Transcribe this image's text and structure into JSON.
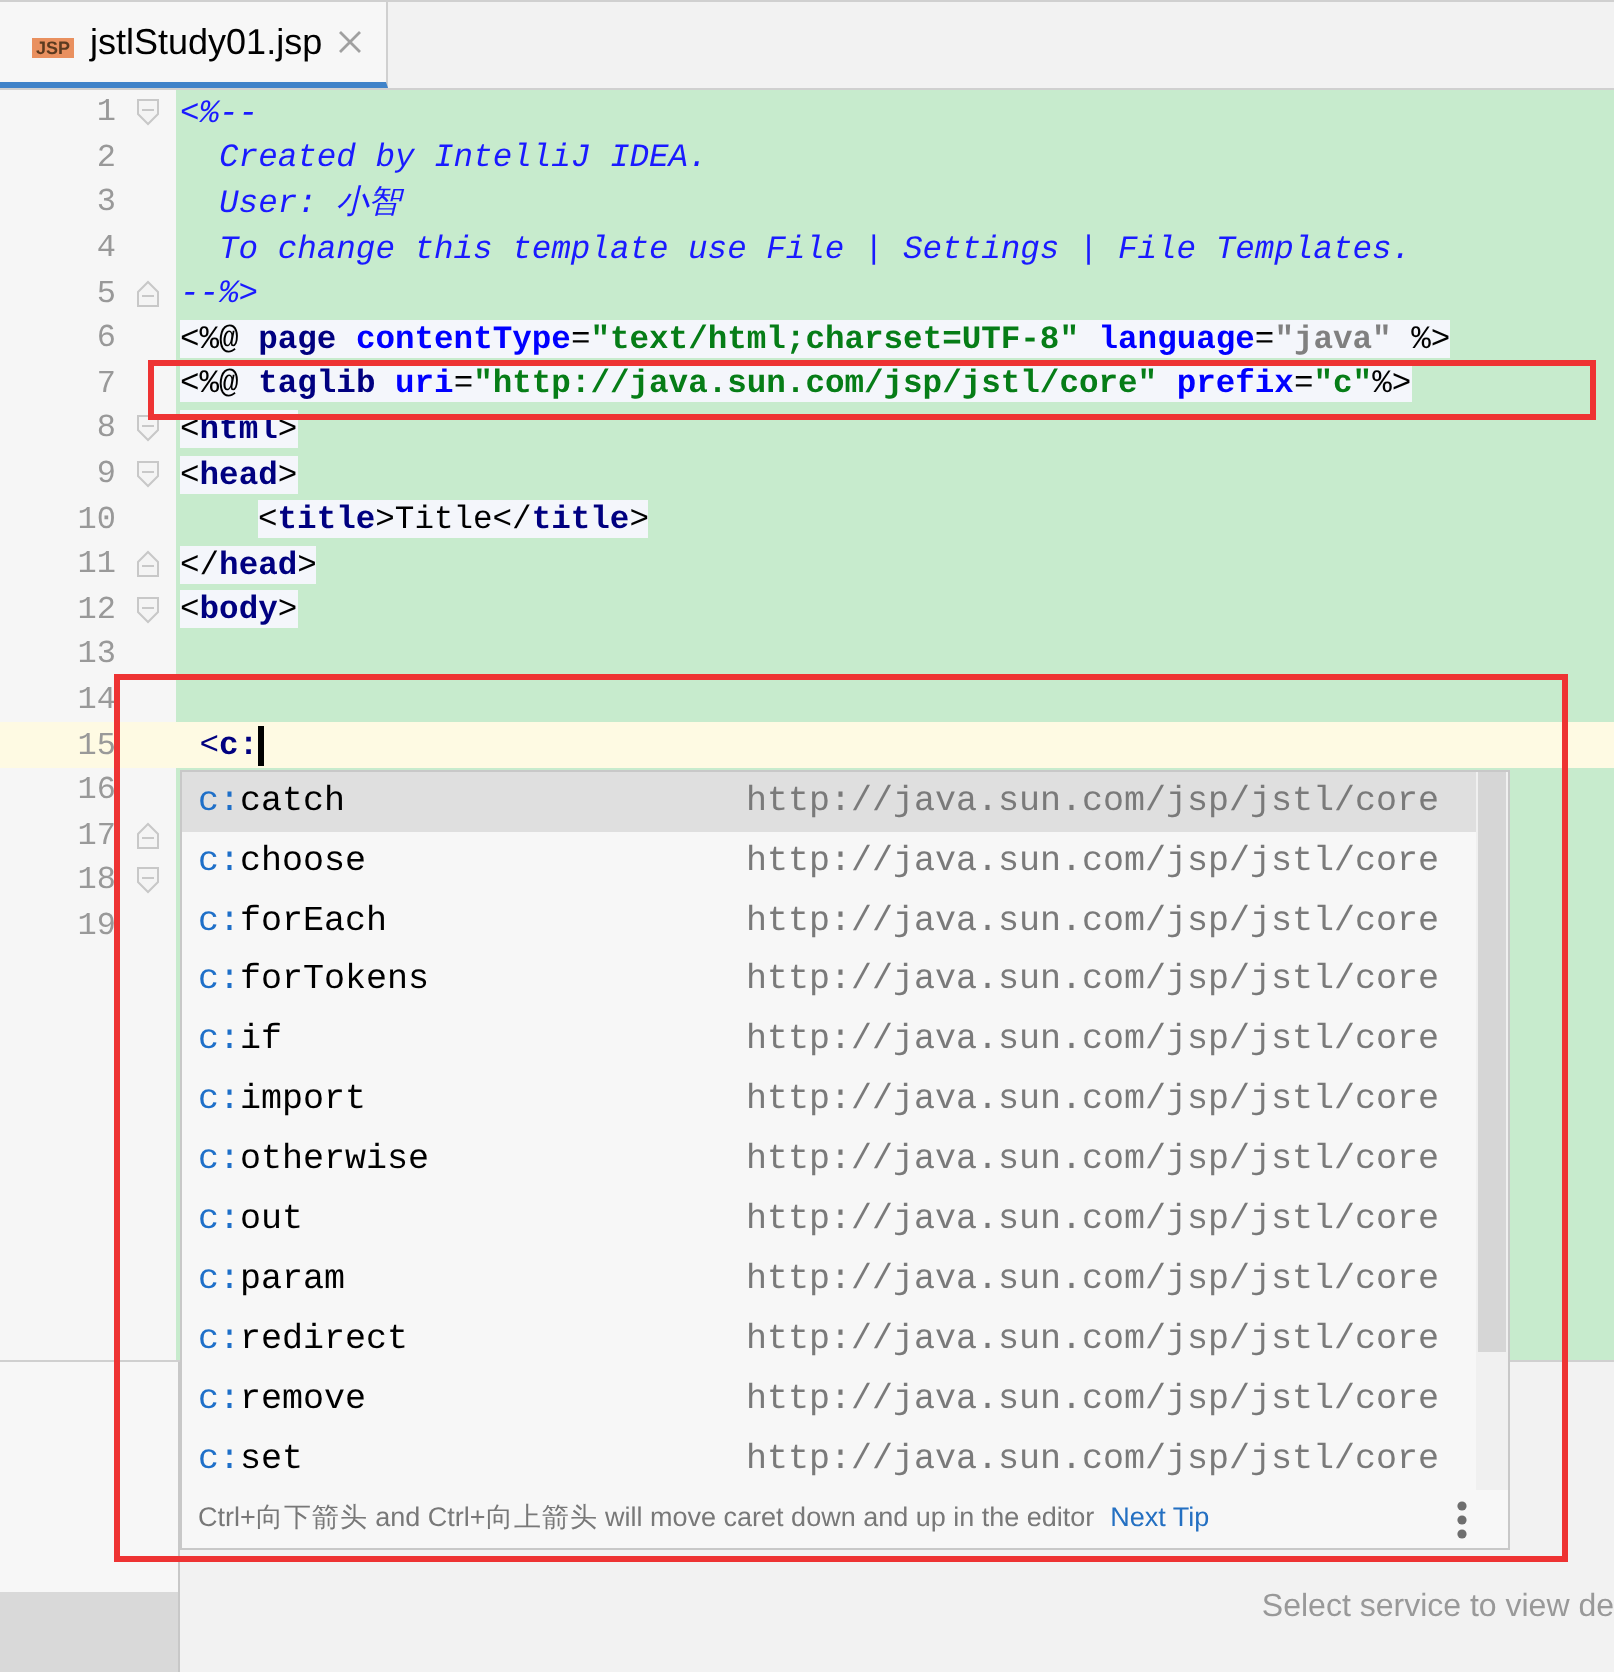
{
  "tabs": [
    {
      "label": "jstlStudy01.jsp",
      "icon": "JSP",
      "selected": true
    }
  ],
  "editor": {
    "lines": [
      {
        "number": "1",
        "fold_start": true,
        "fold_end": false,
        "current": false,
        "indented": false,
        "tokens": [
          {
            "kind": "comment",
            "text": "<%--"
          }
        ]
      },
      {
        "number": "2",
        "fold_start": false,
        "fold_end": false,
        "current": false,
        "indented": false,
        "tokens": [
          {
            "kind": "comment",
            "text": "  Created by IntelliJ IDEA."
          }
        ]
      },
      {
        "number": "3",
        "fold_start": false,
        "fold_end": false,
        "current": false,
        "indented": false,
        "tokens": [
          {
            "kind": "comment",
            "text": "  User: 小智"
          }
        ]
      },
      {
        "number": "4",
        "fold_start": false,
        "fold_end": false,
        "current": false,
        "indented": false,
        "tokens": [
          {
            "kind": "comment",
            "text": "  To change this template use File | Settings | File Templates."
          }
        ]
      },
      {
        "number": "5",
        "fold_start": false,
        "fold_end": true,
        "current": false,
        "indented": false,
        "tokens": [
          {
            "kind": "comment",
            "text": "--%>"
          }
        ]
      },
      {
        "number": "6",
        "fold_start": false,
        "fold_end": false,
        "current": false,
        "indented": false,
        "tokens": [
          {
            "kind": "punct",
            "text": "<%@ "
          },
          {
            "kind": "tag",
            "text": "page"
          },
          {
            "kind": "attr",
            "text": " contentType"
          },
          {
            "kind": "punct",
            "text": "="
          },
          {
            "kind": "value",
            "text": "\"text/html;charset=UTF-8\""
          },
          {
            "kind": "attr",
            "text": " language"
          },
          {
            "kind": "punct",
            "text": "="
          },
          {
            "kind": "muted",
            "text": "\"java\""
          },
          {
            "kind": "punct",
            "text": " %>"
          }
        ]
      },
      {
        "number": "7",
        "fold_start": false,
        "fold_end": false,
        "current": false,
        "indented": false,
        "tokens": [
          {
            "kind": "punct",
            "text": "<%@ "
          },
          {
            "kind": "tag",
            "text": "taglib"
          },
          {
            "kind": "attr",
            "text": " uri"
          },
          {
            "kind": "punct",
            "text": "="
          },
          {
            "kind": "value",
            "text": "\"http://java.sun.com/jsp/jstl/core\""
          },
          {
            "kind": "attr",
            "text": " prefix"
          },
          {
            "kind": "punct",
            "text": "="
          },
          {
            "kind": "value",
            "text": "\"c\""
          },
          {
            "kind": "punct",
            "text": "%>"
          }
        ]
      },
      {
        "number": "8",
        "fold_start": true,
        "fold_end": false,
        "current": false,
        "indented": false,
        "tokens": [
          {
            "kind": "punct",
            "text": "<"
          },
          {
            "kind": "tag",
            "text": "html"
          },
          {
            "kind": "punct",
            "text": ">"
          }
        ]
      },
      {
        "number": "9",
        "fold_start": true,
        "fold_end": false,
        "current": false,
        "indented": false,
        "tokens": [
          {
            "kind": "punct",
            "text": "<"
          },
          {
            "kind": "tag",
            "text": "head"
          },
          {
            "kind": "punct",
            "text": ">"
          }
        ]
      },
      {
        "number": "10",
        "fold_start": false,
        "fold_end": false,
        "current": false,
        "indented": true,
        "tokens": [
          {
            "kind": "punct",
            "text": "<"
          },
          {
            "kind": "tag",
            "text": "title"
          },
          {
            "kind": "punct",
            "text": ">"
          },
          {
            "kind": "text",
            "text": "Title"
          },
          {
            "kind": "punct",
            "text": "</"
          },
          {
            "kind": "tag",
            "text": "title"
          },
          {
            "kind": "punct",
            "text": ">"
          }
        ]
      },
      {
        "number": "11",
        "fold_start": false,
        "fold_end": true,
        "current": false,
        "indented": false,
        "tokens": [
          {
            "kind": "punct",
            "text": "</"
          },
          {
            "kind": "tag",
            "text": "head"
          },
          {
            "kind": "punct",
            "text": ">"
          }
        ]
      },
      {
        "number": "12",
        "fold_start": true,
        "fold_end": false,
        "current": false,
        "indented": false,
        "tokens": [
          {
            "kind": "punct",
            "text": "<"
          },
          {
            "kind": "tag",
            "text": "body"
          },
          {
            "kind": "punct",
            "text": ">"
          }
        ]
      },
      {
        "number": "13",
        "fold_start": false,
        "fold_end": false,
        "current": false
      },
      {
        "number": "14",
        "fold_start": false,
        "fold_end": false,
        "current": false
      },
      {
        "number": "15",
        "fold_start": false,
        "fold_end": false,
        "current": true,
        "indented": false,
        "tokens": [
          {
            "kind": "plain",
            "text": " <"
          },
          {
            "kind": "plain-bold",
            "text": "c:"
          }
        ]
      },
      {
        "number": "16",
        "fold_start": false,
        "fold_end": false,
        "current": false
      },
      {
        "number": "17",
        "fold_start": false,
        "fold_end": true,
        "current": false
      },
      {
        "number": "18",
        "fold_start": true,
        "fold_end": false,
        "current": false
      },
      {
        "number": "19",
        "fold_start": false,
        "fold_end": false,
        "current": false
      }
    ]
  },
  "completion": {
    "items": [
      {
        "prefix": "c:",
        "name": "catch",
        "uri": "http://java.sun.com/jsp/jstl/core",
        "selected": true
      },
      {
        "prefix": "c:",
        "name": "choose",
        "uri": "http://java.sun.com/jsp/jstl/core",
        "selected": false
      },
      {
        "prefix": "c:",
        "name": "forEach",
        "uri": "http://java.sun.com/jsp/jstl/core",
        "selected": false
      },
      {
        "prefix": "c:",
        "name": "forTokens",
        "uri": "http://java.sun.com/jsp/jstl/core",
        "selected": false
      },
      {
        "prefix": "c:",
        "name": "if",
        "uri": "http://java.sun.com/jsp/jstl/core",
        "selected": false
      },
      {
        "prefix": "c:",
        "name": "import",
        "uri": "http://java.sun.com/jsp/jstl/core",
        "selected": false
      },
      {
        "prefix": "c:",
        "name": "otherwise",
        "uri": "http://java.sun.com/jsp/jstl/core",
        "selected": false
      },
      {
        "prefix": "c:",
        "name": "out",
        "uri": "http://java.sun.com/jsp/jstl/core",
        "selected": false
      },
      {
        "prefix": "c:",
        "name": "param",
        "uri": "http://java.sun.com/jsp/jstl/core",
        "selected": false
      },
      {
        "prefix": "c:",
        "name": "redirect",
        "uri": "http://java.sun.com/jsp/jstl/core",
        "selected": false
      },
      {
        "prefix": "c:",
        "name": "remove",
        "uri": "http://java.sun.com/jsp/jstl/core",
        "selected": false
      },
      {
        "prefix": "c:",
        "name": "set",
        "uri": "http://java.sun.com/jsp/jstl/core",
        "selected": false
      }
    ],
    "tip": "Ctrl+向下箭头 and Ctrl+向上箭头 will move caret down and up in the editor",
    "tip_link": "Next Tip"
  },
  "services": {
    "placeholder_text": "Select service to view de"
  }
}
